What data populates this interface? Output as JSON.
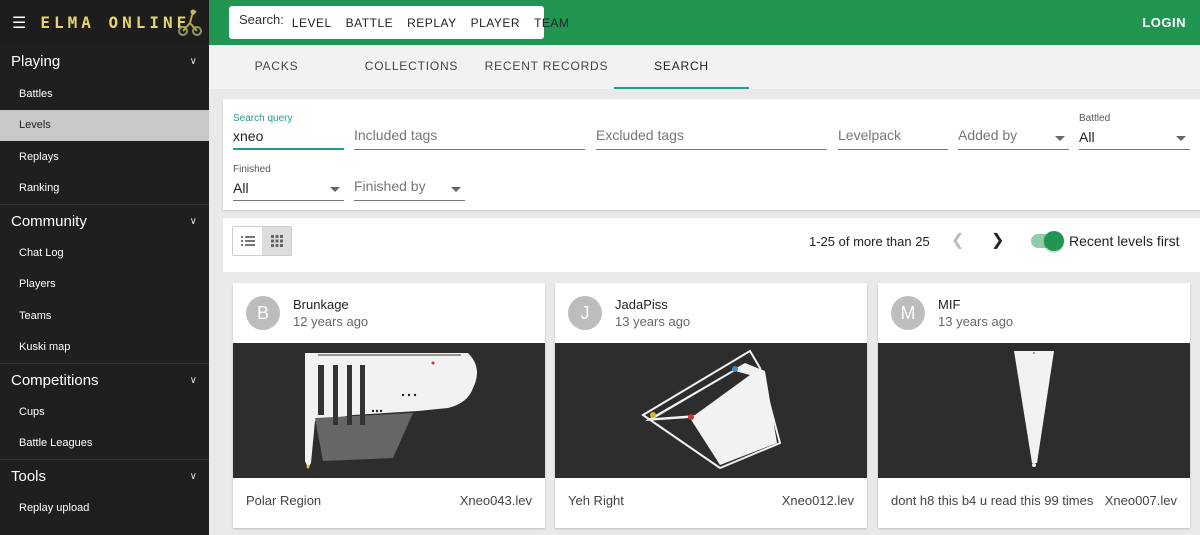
{
  "header": {
    "brand": "ELMA ONLINE",
    "search_label": "Search:",
    "search_options": [
      "LEVEL",
      "BATTLE",
      "REPLAY",
      "PLAYER",
      "TEAM"
    ],
    "login": "LOGIN"
  },
  "sidebar": {
    "sections": [
      {
        "title": "Playing",
        "items": [
          "Battles",
          "Levels",
          "Replays",
          "Ranking"
        ]
      },
      {
        "title": "Community",
        "items": [
          "Chat Log",
          "Players",
          "Teams",
          "Kuski map"
        ]
      },
      {
        "title": "Competitions",
        "items": [
          "Cups",
          "Battle Leagues"
        ]
      },
      {
        "title": "Tools",
        "items": [
          "Replay upload"
        ]
      }
    ],
    "active_item": "Levels"
  },
  "tabs": [
    "PACKS",
    "COLLECTIONS",
    "RECENT RECORDS",
    "SEARCH"
  ],
  "active_tab": "SEARCH",
  "filters": {
    "search_query_label": "Search query",
    "search_query_value": "xneo",
    "included_tags_placeholder": "Included tags",
    "excluded_tags_placeholder": "Excluded tags",
    "levelpack_placeholder": "Levelpack",
    "added_by_placeholder": "Added by",
    "battled_label": "Battled",
    "battled_value": "All",
    "finished_label": "Finished",
    "finished_value": "All",
    "finished_by_placeholder": "Finished by"
  },
  "toolbar": {
    "paging_text": "1-25 of more than 25",
    "toggle_label": "Recent levels first",
    "toggle_on": true,
    "view_mode": "grid"
  },
  "cards": [
    {
      "initial": "B",
      "author": "Brunkage",
      "age": "12 years ago",
      "level_name": "Polar Region",
      "filename": "Xneo043.lev"
    },
    {
      "initial": "J",
      "author": "JadaPiss",
      "age": "13 years ago",
      "level_name": "Yeh Right",
      "filename": "Xneo012.lev"
    },
    {
      "initial": "M",
      "author": "MIF",
      "age": "13 years ago",
      "level_name": "dont h8 this b4 u read this 99 times",
      "filename": "Xneo007.lev"
    }
  ],
  "colors": {
    "brand_green": "#219653",
    "accent_teal": "#219e8a",
    "sidebar_bg": "#1f1f1f"
  },
  "icons": [
    "menu-icon",
    "chevron-down-icon",
    "list-view-icon",
    "grid-view-icon",
    "chevron-left-icon",
    "chevron-right-icon"
  ]
}
